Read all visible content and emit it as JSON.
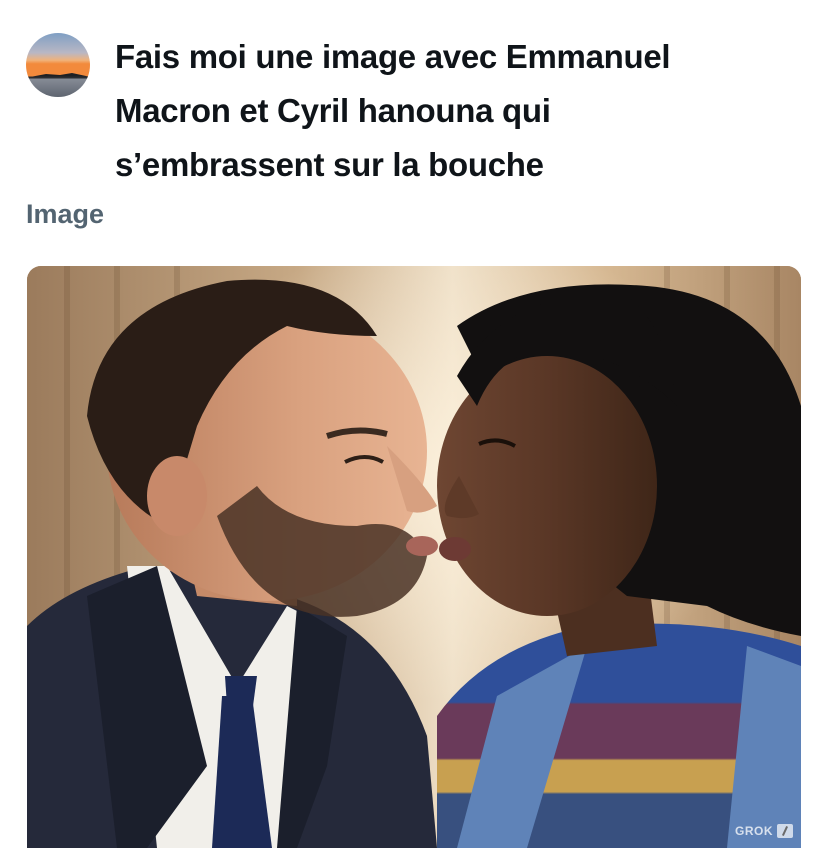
{
  "user": {
    "avatar_icon": "sunset-avatar-icon"
  },
  "prompt": {
    "line1": "Fais moi une image avec Emmanuel",
    "line2": "Macron et Cyril hanouna qui",
    "line3": "s’embrassent sur la bouche"
  },
  "result": {
    "section_label": "Image",
    "image_alt": "AI-generated image of two people about to kiss",
    "watermark": "GROK"
  },
  "colors": {
    "text_primary": "#0f1419",
    "text_secondary": "#536471",
    "background": "#ffffff"
  }
}
